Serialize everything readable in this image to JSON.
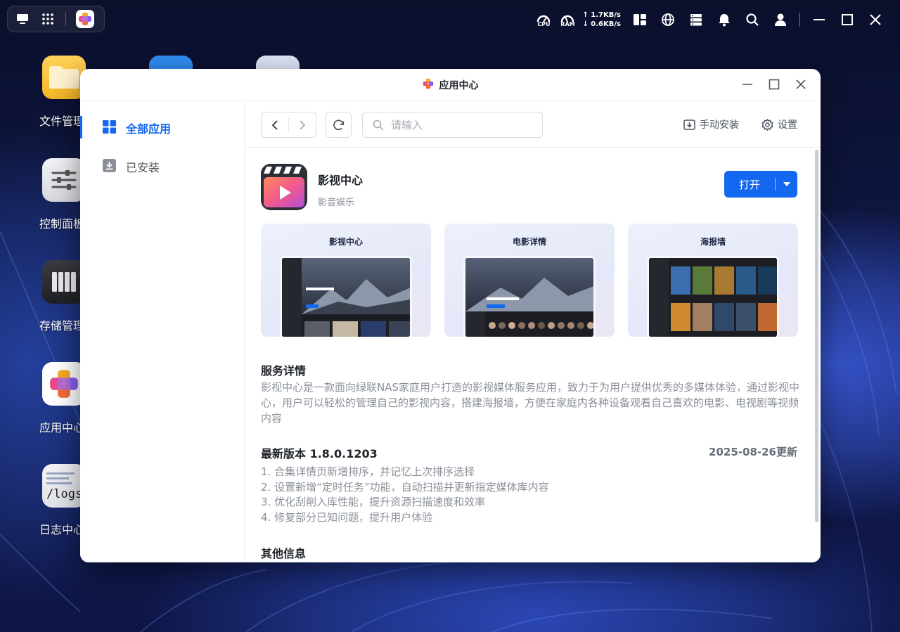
{
  "desktop": {
    "icons": [
      {
        "label": "文件管理"
      },
      {
        "label": "控制面板"
      },
      {
        "label": "存储管理"
      },
      {
        "label": "应用中心"
      },
      {
        "label": "日志中心"
      }
    ],
    "logs_icon_text": "/logs"
  },
  "topbar": {
    "cpu_label": "CPU",
    "ram_label": "RAM",
    "upload_speed": "↑ 1.7KB/s",
    "download_speed": "↓ 0.6KB/s"
  },
  "window": {
    "title": "应用中心"
  },
  "sidebar": {
    "items": [
      {
        "label": "全部应用",
        "active": true
      },
      {
        "label": "已安装",
        "active": false
      }
    ]
  },
  "toolbar": {
    "search_placeholder": "请输入",
    "manual_install": "手动安装",
    "settings": "设置"
  },
  "app": {
    "name": "影视中心",
    "category": "影音娱乐",
    "open_label": "打开"
  },
  "screenshots": [
    {
      "title": "影视中心"
    },
    {
      "title": "电影详情"
    },
    {
      "title": "海报墙"
    }
  ],
  "service": {
    "title": "服务详情",
    "description": "影视中心是一款面向绿联NAS家庭用户打造的影视媒体服务应用，致力于为用户提供优秀的多媒体体验，通过影视中心，用户可以轻松的管理自己的影视内容，搭建海报墙，方便在家庭内各种设备观看自己喜欢的电影、电视剧等视频内容"
  },
  "version": {
    "title": "最新版本 1.8.0.1203",
    "date": "2025-08-26更新",
    "notes": [
      "1. 合集详情页新增排序，并记忆上次排序选择",
      "2. 设置新增“定时任务”功能，自动扫描并更新指定媒体库内容",
      "3. 优化刮削入库性能，提升资源扫描速度和效率",
      "4. 修复部分已知问题，提升用户体验"
    ]
  },
  "other": {
    "title": "其他信息"
  },
  "colors": {
    "accent": "#1468f0"
  }
}
